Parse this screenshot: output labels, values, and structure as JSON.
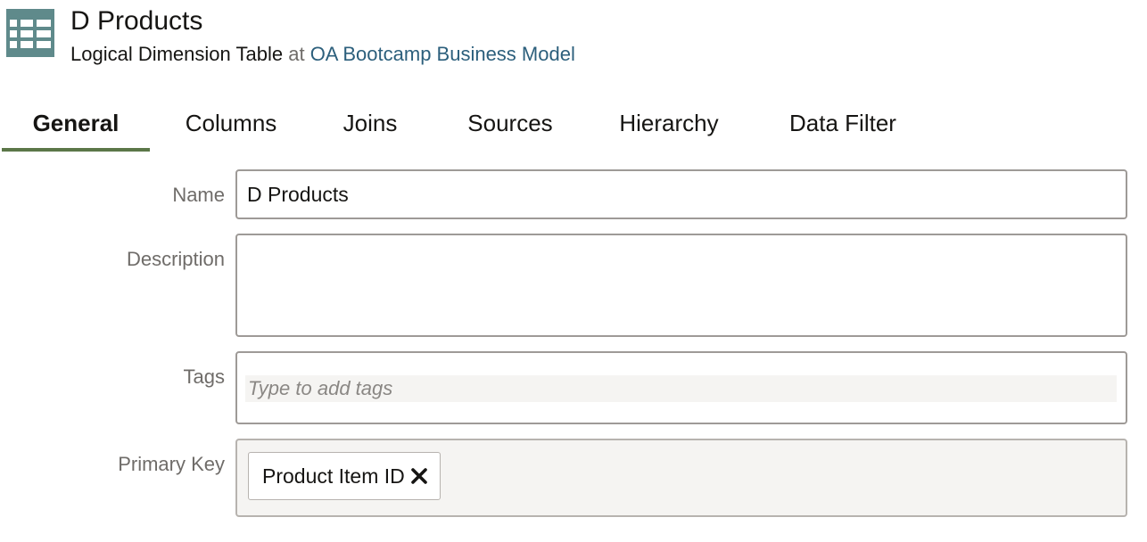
{
  "header": {
    "icon": "table-icon",
    "title": "D Products",
    "object_type": "Logical Dimension Table",
    "at_word": "at",
    "parent_link": "OA Bootcamp Business Model"
  },
  "tabs": [
    {
      "label": "General",
      "active": true
    },
    {
      "label": "Columns",
      "active": false
    },
    {
      "label": "Joins",
      "active": false
    },
    {
      "label": "Sources",
      "active": false
    },
    {
      "label": "Hierarchy",
      "active": false
    },
    {
      "label": "Data Filter",
      "active": false
    }
  ],
  "form": {
    "name": {
      "label": "Name",
      "value": "D Products"
    },
    "description": {
      "label": "Description",
      "value": ""
    },
    "tags": {
      "label": "Tags",
      "placeholder": "Type to add tags"
    },
    "primary_key": {
      "label": "Primary Key",
      "chips": [
        {
          "label": "Product Item ID",
          "remove_icon": "close-icon"
        }
      ]
    }
  },
  "colors": {
    "accent_tab_underline": "#5b7748",
    "icon_fill": "#5f8a8b",
    "link": "#2c5f7c",
    "label_gray": "#6f6c69"
  }
}
